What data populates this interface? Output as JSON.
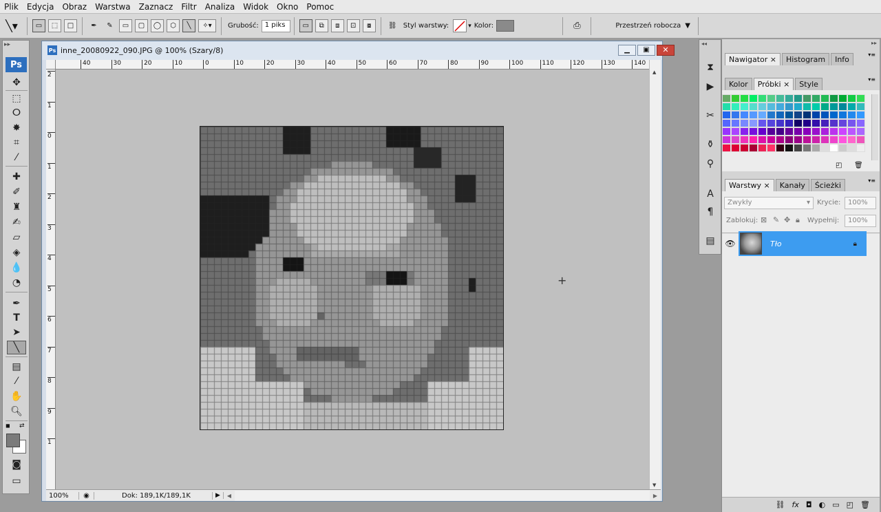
{
  "menu": [
    "Plik",
    "Edycja",
    "Obraz",
    "Warstwa",
    "Zaznacz",
    "Filtr",
    "Analiza",
    "Widok",
    "Okno",
    "Pomoc"
  ],
  "options": {
    "weight_label": "Grubość:",
    "weight_value": "1 piks",
    "layer_style_label": "Styl warstwy:",
    "color_label": "Kolor:",
    "color_swatch": "#8a8a8a",
    "workspace_label": "Przestrzeń robocza"
  },
  "document": {
    "title": "inne_20080922_090.JPG @ 100% (Szary/8)",
    "zoom": "100%",
    "doc_info": "Dok: 189,1K/189,1K",
    "ruler_top_labels": [
      "40",
      "30",
      "20",
      "10",
      "0",
      "10",
      "20",
      "30",
      "40",
      "50",
      "60",
      "70",
      "80",
      "90",
      "100",
      "110",
      "120",
      "130",
      "140"
    ],
    "ruler_left_labels": [
      "2",
      "1",
      "0",
      "1",
      "2",
      "3",
      "4",
      "5",
      "6",
      "7",
      "8",
      "9",
      "1"
    ]
  },
  "panels": {
    "group1_tabs": [
      "Nawigator",
      "Histogram",
      "Info"
    ],
    "group2_tabs": [
      "Kolor",
      "Próbki",
      "Style"
    ],
    "group3_tabs": [
      "Warstwy",
      "Kanały",
      "Ścieżki"
    ],
    "blend_mode": "Zwykły",
    "opacity_label": "Krycie:",
    "opacity_value": "100%",
    "lock_label": "Zablokuj:",
    "fill_label": "Wypełnij:",
    "fill_value": "100%",
    "layer_name": "Tło"
  },
  "colors": {
    "ps_blue": "#2d6fbe",
    "layer_selected": "#3d9cf0",
    "foreground": "#7b7b7b",
    "background": "#ffffff"
  }
}
